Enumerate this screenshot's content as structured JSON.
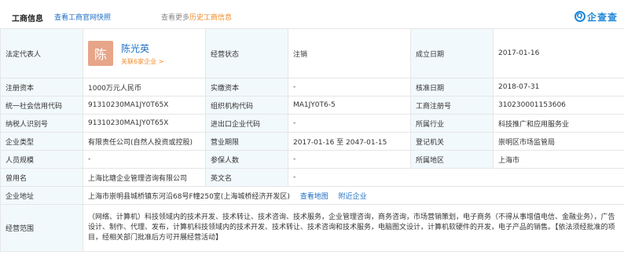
{
  "header": {
    "title": "工商信息",
    "snapshot_link": "查看工商官网快照",
    "history_prefix": "查看更多",
    "history_link": "历史工商信息",
    "logo_text": "企查查",
    "logo_mark": "Q"
  },
  "rows": [
    {
      "label": "法定代表人"
    },
    {
      "label": "注册资本"
    },
    {
      "label": "统一社会信用代码"
    },
    {
      "label": "纳税人识别号"
    },
    {
      "label": "企业类型"
    },
    {
      "label": "人员规模"
    },
    {
      "label": "曾用名"
    },
    {
      "label": "企业地址"
    },
    {
      "label": "经营范围"
    }
  ],
  "rep": {
    "avatar_char": "陈",
    "name": "陈光英",
    "related": "关联6家企业 >"
  },
  "fields": {
    "status_label": "经营状态",
    "status": "注销",
    "founded_label": "成立日期",
    "founded": "2017-01-16",
    "capital": "1000万元人民币",
    "paid_label": "实缴资本",
    "paid": "-",
    "approved_label": "核准日期",
    "approved": "2018-07-31",
    "credit_code": "91310230MA1JY0T65X",
    "org_code_label": "组织机构代码",
    "org_code": "MA1JY0T6-5",
    "reg_no_label": "工商注册号",
    "reg_no": "310230001153606",
    "tax_id": "91310230MA1JY0T65X",
    "import_label": "进出口企业代码",
    "import": "-",
    "industry_label": "所属行业",
    "industry": "科技推广和应用服务业",
    "type": "有限责任公司(自然人投资或控股)",
    "term_label": "营业期限",
    "term": "2017-01-16 至 2047-01-15",
    "authority_label": "登记机关",
    "authority": "崇明区市场监管局",
    "staff": "-",
    "insured_label": "参保人数",
    "insured": "-",
    "region_label": "所属地区",
    "region": "上海市",
    "former_name": "上海比瑭企业管理咨询有限公司",
    "english_label": "英文名",
    "english": "-",
    "address": "上海市崇明县城桥镇东河沿68号F幢250室(上海城桥经济开发区)",
    "view_map": "查看地图",
    "nearby": "附近企业",
    "scope": "（网络、计算机）科技领域内的技术开发、技术转让、技术咨询、技术服务，企业管理咨询，商务咨询，市场营销策划，电子商务（不得从事增值电信、金融业务），广告设计、制作、代理、发布，计算机科技领域内的技术开发、技术转让、技术咨询和技术服务，电脑图文设计，计算机软硬件的开发，电子产品的销售。【依法须经批准的项目，经相关部门批准后方可开展经营活动】"
  }
}
